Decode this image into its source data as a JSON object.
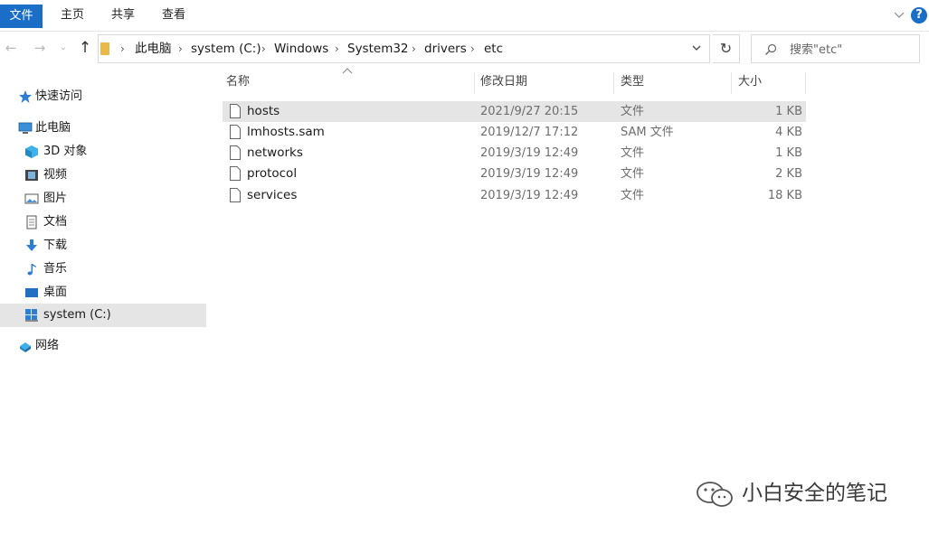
{
  "ribbon": {
    "tabs": [
      "文件",
      "主页",
      "共享",
      "查看"
    ],
    "help": "?"
  },
  "nav": {
    "breadcrumb": [
      "此电脑",
      "system (C:)",
      "Windows",
      "System32",
      "drivers",
      "etc"
    ],
    "search_placeholder": "搜索\"etc\""
  },
  "sidebar": {
    "items": [
      {
        "label": "快速访问",
        "icon": "star-icon"
      },
      {
        "label": "此电脑",
        "icon": "computer-icon"
      },
      {
        "label": "3D 对象",
        "icon": "cube-3d-icon"
      },
      {
        "label": "视频",
        "icon": "video-icon"
      },
      {
        "label": "图片",
        "icon": "picture-icon"
      },
      {
        "label": "文档",
        "icon": "document-icon"
      },
      {
        "label": "下载",
        "icon": "download-icon"
      },
      {
        "label": "音乐",
        "icon": "music-icon"
      },
      {
        "label": "桌面",
        "icon": "desktop-icon"
      },
      {
        "label": "system (C:)",
        "icon": "drive-icon"
      },
      {
        "label": "网络",
        "icon": "network-icon"
      }
    ],
    "selected": "system (C:)"
  },
  "columns": [
    "名称",
    "修改日期",
    "类型",
    "大小"
  ],
  "files": [
    {
      "name": "hosts",
      "date": "2021/9/27 20:15",
      "type": "文件",
      "size": "1 KB"
    },
    {
      "name": "lmhosts.sam",
      "date": "2019/12/7 17:12",
      "type": "SAM 文件",
      "size": "4 KB"
    },
    {
      "name": "networks",
      "date": "2019/3/19 12:49",
      "type": "文件",
      "size": "1 KB"
    },
    {
      "name": "protocol",
      "date": "2019/3/19 12:49",
      "type": "文件",
      "size": "2 KB"
    },
    {
      "name": "services",
      "date": "2019/3/19 12:49",
      "type": "文件",
      "size": "18 KB"
    }
  ],
  "selected_file": "hosts",
  "watermark": "小白安全的笔记",
  "colors": {
    "accent": "#1a6ec7",
    "selection": "#e5e5e5",
    "folder": "#e9b94a"
  }
}
